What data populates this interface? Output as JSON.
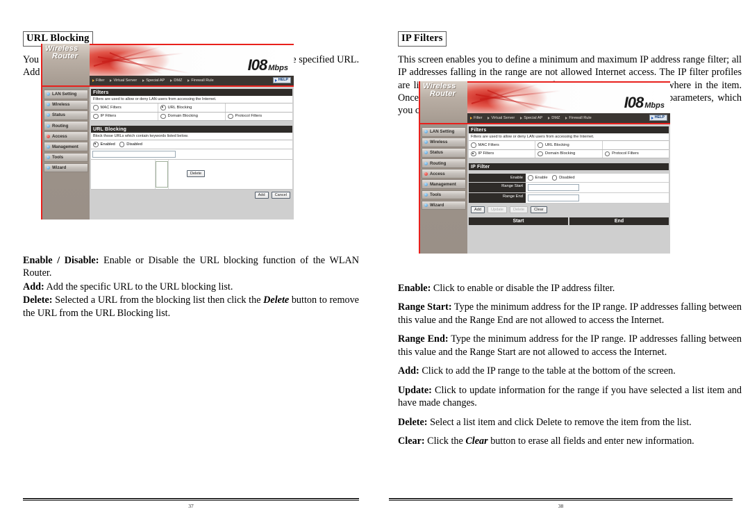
{
  "left_page": {
    "heading": "URL Blocking",
    "intro": "You could enable URL blocking to deny the users from accessing the specified URL.  Add those specified URL in the text box.",
    "page_number": "37",
    "screenshot": {
      "brand_line1": "Wireless",
      "brand_line2": "Router",
      "speed_number": "I08",
      "speed_unit": "Mbps",
      "nav": [
        "Filter",
        "Virtual Server",
        "Special AP",
        "DMZ",
        "Firewall Rule"
      ],
      "help_label": "HELP",
      "sidebar": [
        {
          "label": "LAN Setting",
          "active": false
        },
        {
          "label": "Wireless",
          "active": false
        },
        {
          "label": "Status",
          "active": false
        },
        {
          "label": "Routing",
          "active": false
        },
        {
          "label": "Access",
          "active": true
        },
        {
          "label": "Management",
          "active": false
        },
        {
          "label": "Tools",
          "active": false
        },
        {
          "label": "Wizard",
          "active": false
        }
      ],
      "filters_title": "Filters",
      "filters_note": "Filters are used to allow or deny LAN users from accessing the Internet.",
      "filter_options_row1": [
        {
          "label": "MAC Filters",
          "selected": false
        },
        {
          "label": "URL Blocking",
          "selected": true
        }
      ],
      "filter_options_row2": [
        {
          "label": "IP Filters",
          "selected": false
        },
        {
          "label": "Domain Blocking",
          "selected": false
        },
        {
          "label": "Protocol Filters",
          "selected": false
        }
      ],
      "url_panel_title": "URL Blocking",
      "url_panel_note": "Block those URLs which contain keywords listed below.",
      "url_enable_options": [
        {
          "label": "Enabled",
          "selected": true
        },
        {
          "label": "Disabled",
          "selected": false
        }
      ],
      "url_input_value": "",
      "delete_button": "Delete",
      "add_button": "Add",
      "cancel_button": "Cancel"
    },
    "terms": [
      {
        "term": "Enable / Disable:",
        "text": " Enable or Disable the URL blocking function of the WLAN Router."
      },
      {
        "term": "Add:",
        "text": " Add the specific URL to the URL blocking list."
      },
      {
        "term": "Delete:",
        "text": " Selected a URL from the blocking list then click the ",
        "emph": "Delete",
        "text2": " button to remove the URL from the URL Blocking list."
      }
    ]
  },
  "right_page": {
    "heading": "IP Filters",
    "intro": "This screen enables you to define a minimum and maximum IP address range filter; all IP addresses falling in the range are not allowed Internet access.  The IP filter profiles are listed in the table at the bottom of the page. (Note: Click anywhere in the item. Once the line is selected, the fields automatically load the item's parameters, which you can edit.)",
    "page_number": "38",
    "screenshot": {
      "brand_line1": "Wireless",
      "brand_line2": "Router",
      "speed_number": "I08",
      "speed_unit": "Mbps",
      "nav": [
        "Filter",
        "Virtual Server",
        "Special AP",
        "DMZ",
        "Firewall Rule"
      ],
      "help_label": "HELP",
      "sidebar": [
        {
          "label": "LAN Setting",
          "active": false
        },
        {
          "label": "Wireless",
          "active": false
        },
        {
          "label": "Status",
          "active": false
        },
        {
          "label": "Routing",
          "active": false
        },
        {
          "label": "Access",
          "active": true
        },
        {
          "label": "Management",
          "active": false
        },
        {
          "label": "Tools",
          "active": false
        },
        {
          "label": "Wizard",
          "active": false
        }
      ],
      "filters_title": "Filters",
      "filters_note": "Filters are used to allow or deny LAN users from accessing the Internet.",
      "filter_options_row1": [
        {
          "label": "MAC Filters",
          "selected": false
        },
        {
          "label": "URL Blocking",
          "selected": false
        }
      ],
      "filter_options_row2": [
        {
          "label": "IP Filters",
          "selected": true
        },
        {
          "label": "Domain Blocking",
          "selected": false
        },
        {
          "label": "Protocol Filters",
          "selected": false
        }
      ],
      "ip_panel_title": "IP Filter",
      "form_rows": [
        {
          "label": "Enable",
          "type": "radio",
          "options": [
            {
              "label": "Enable",
              "selected": false
            },
            {
              "label": "Disabled",
              "selected": false
            }
          ]
        },
        {
          "label": "Range Start",
          "type": "text",
          "value": ""
        },
        {
          "label": "Range End",
          "type": "text",
          "value": ""
        }
      ],
      "buttons": [
        {
          "label": "Add",
          "enabled": true
        },
        {
          "label": "Update",
          "enabled": false
        },
        {
          "label": "Delete",
          "enabled": false
        },
        {
          "label": "Clear",
          "enabled": true
        }
      ],
      "table_headers": [
        "Start",
        "End"
      ]
    },
    "terms": [
      {
        "term": "Enable:",
        "text": " Click to enable or disable the IP address filter."
      },
      {
        "term": "Range Start:",
        "text": " Type the minimum address for the IP range. IP addresses falling between this value and the Range End are not allowed to access the Internet."
      },
      {
        "term": "Range End:",
        "text": " Type the minimum address for the IP range. IP addresses falling between this value and the Range Start are not allowed to access the Internet."
      },
      {
        "term": "Add:",
        "text": " Click to add the IP range to the table at the bottom of the screen."
      },
      {
        "term": "Update:",
        "text": " Click to update information for the range if you have selected a list item and have made changes."
      },
      {
        "term": "Delete:",
        "text": " Select a list item and click Delete to remove the item from the list."
      },
      {
        "term": "Clear:",
        "text": " Click the ",
        "emph": "Clear",
        "text2": " button to erase all fields and enter new information."
      }
    ]
  }
}
